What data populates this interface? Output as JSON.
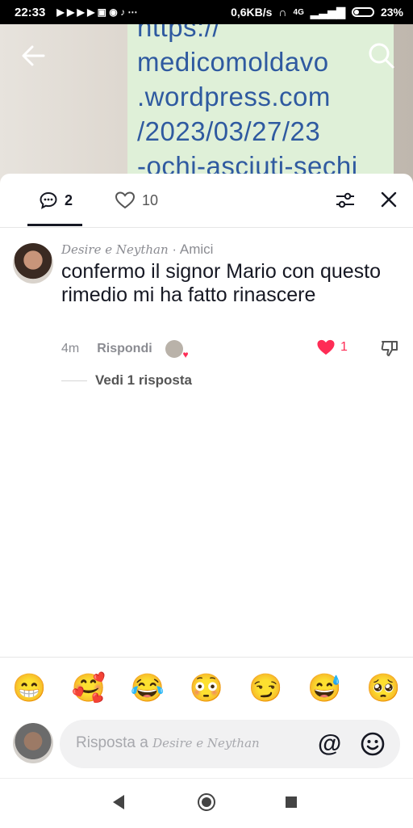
{
  "status_bar": {
    "time": "22:33",
    "speed": "0,6KB/s",
    "network": "4G",
    "battery": "23%"
  },
  "video_overlay": {
    "link_lines": [
      "https://",
      "medicomoldavo",
      ".wordpress.com",
      "/2023/03/27/23",
      "-ochi-asciuti-sechi"
    ]
  },
  "tabs": {
    "comments_count": "2",
    "likes_count": "10"
  },
  "comment": {
    "author": "Desire e Neythan",
    "relation": "· Amici",
    "text": "confermo il signor Mario con questo rimedio mi ha fatto rinascere",
    "time": "4m",
    "reply_label": "Rispondi",
    "likes": "1",
    "view_replies": "Vedi 1 risposta"
  },
  "emoji_bar": [
    "😁",
    "🥰",
    "😂",
    "😳",
    "😏",
    "😅",
    "🥺"
  ],
  "reply_input": {
    "prefix": "Risposta a",
    "name": "Desire e Neythan",
    "mention_symbol": "@"
  },
  "colors": {
    "accent_like": "#fe2c55",
    "text_primary": "#161823",
    "text_secondary": "#8a8b91"
  }
}
